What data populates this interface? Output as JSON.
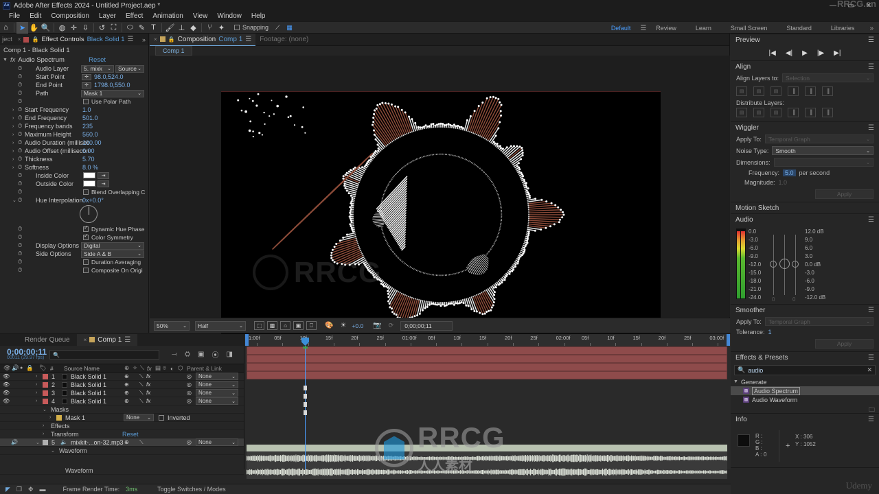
{
  "app": {
    "title": "Adobe After Effects 2024 - Untitled Project.aep *",
    "badge": "Ae",
    "window_buttons": [
      "—",
      "▭",
      "✕"
    ]
  },
  "menu": [
    "File",
    "Edit",
    "Composition",
    "Layer",
    "Effect",
    "Animation",
    "View",
    "Window",
    "Help"
  ],
  "toolbar": {
    "tools": [
      {
        "name": "home-icon",
        "glyph": "⌂"
      },
      {
        "name": "selection-tool-icon",
        "glyph": "➤"
      },
      {
        "name": "hand-tool-icon",
        "glyph": "✋"
      },
      {
        "name": "zoom-tool-icon",
        "glyph": "🔍"
      },
      {
        "name": "orbit-tool-icon",
        "glyph": "◍"
      },
      {
        "name": "pan-behind-tool-icon",
        "glyph": "✛"
      },
      {
        "name": "camera-tool-icon",
        "glyph": "⇩"
      },
      {
        "name": "rotation-tool-icon",
        "glyph": "↺"
      },
      {
        "name": "region-of-interest-icon",
        "glyph": "⛶"
      },
      {
        "name": "shape-tool-icon",
        "glyph": "⬭"
      },
      {
        "name": "pen-tool-icon",
        "glyph": "✎"
      },
      {
        "name": "type-tool-icon",
        "glyph": "T"
      },
      {
        "name": "brush-tool-icon",
        "glyph": "🖌"
      },
      {
        "name": "clone-stamp-tool-icon",
        "glyph": "⊥"
      },
      {
        "name": "eraser-tool-icon",
        "glyph": "◆"
      },
      {
        "name": "roto-brush-tool-icon",
        "glyph": "⑂"
      },
      {
        "name": "puppet-pin-tool-icon",
        "glyph": "✦"
      }
    ],
    "snapping_label": "Snapping",
    "snapping_checked": false
  },
  "workspaces": {
    "items": [
      "Default",
      "Review",
      "Learn",
      "Small Screen",
      "Standard",
      "Libraries"
    ],
    "active": "Default",
    "overflow": "»"
  },
  "effect_controls": {
    "tabs": [
      {
        "label": "ject",
        "active": false
      },
      {
        "label": "Effect Controls",
        "value": "Black Solid 1",
        "active": true
      }
    ],
    "subtitle": "Comp 1 - Black Solid 1",
    "effect_name": "Audio Spectrum",
    "reset_label": "Reset",
    "properties": [
      {
        "label": "Audio Layer",
        "indent": true,
        "type": "dual-dropdown",
        "value": "5. mixk",
        "value2": "Source"
      },
      {
        "label": "Start Point",
        "indent": true,
        "type": "point",
        "value": "98.0,524.0"
      },
      {
        "label": "End Point",
        "indent": true,
        "type": "point",
        "value": "1798.0,550.0"
      },
      {
        "label": "Path",
        "indent": true,
        "type": "dropdown",
        "value": "Mask 1"
      },
      {
        "label": "",
        "indent": true,
        "type": "checkbox",
        "value": "Use Polar Path",
        "checked": false
      },
      {
        "label": "Start Frequency",
        "indent": false,
        "type": "number",
        "value": "1.0"
      },
      {
        "label": "End Frequency",
        "indent": false,
        "type": "number",
        "value": "501.0"
      },
      {
        "label": "Frequency bands",
        "indent": false,
        "type": "number",
        "value": "235"
      },
      {
        "label": "Maximum Height",
        "indent": false,
        "type": "number",
        "value": "560.0"
      },
      {
        "label": "Audio Duration (millisec",
        "indent": false,
        "type": "number",
        "value": "100.00"
      },
      {
        "label": "Audio Offset (millisecon",
        "indent": false,
        "type": "number",
        "value": "0.00"
      },
      {
        "label": "Thickness",
        "indent": false,
        "type": "number",
        "value": "5.70"
      },
      {
        "label": "Softness",
        "indent": false,
        "type": "number",
        "value": "8.0 %"
      },
      {
        "label": "Inside Color",
        "indent": true,
        "type": "color",
        "value": "#ffffff"
      },
      {
        "label": "Outside Color",
        "indent": true,
        "type": "color",
        "value": "#ffffff"
      },
      {
        "label": "",
        "indent": true,
        "type": "checkbox",
        "value": "Blend Overlapping C",
        "checked": false
      },
      {
        "label": "Hue Interpolation",
        "indent": true,
        "type": "angle",
        "value": "0x+0.0°"
      },
      {
        "label": "",
        "indent": true,
        "type": "checkbox",
        "value": "Dynamic Hue Phase",
        "checked": true
      },
      {
        "label": "",
        "indent": true,
        "type": "checkbox",
        "value": "Color Symmetry",
        "checked": true
      },
      {
        "label": "Display Options",
        "indent": true,
        "type": "dropdown",
        "value": "Digital"
      },
      {
        "label": "Side Options",
        "indent": true,
        "type": "dropdown",
        "value": "Side A & B"
      },
      {
        "label": "",
        "indent": true,
        "type": "checkbox",
        "value": "Duration Averaging",
        "checked": false
      },
      {
        "label": "",
        "indent": true,
        "type": "checkbox",
        "value": "Composite On Origi",
        "checked": false
      }
    ]
  },
  "composition": {
    "tab_label": "Composition",
    "tab_value": "Comp 1",
    "footage_label": "Footage: (none)",
    "view_tab": "Comp 1",
    "viewer_bar": {
      "zoom": "50%",
      "resolution": "Half",
      "exposure": "+0.0",
      "timecode": "0;00;00;11",
      "icons": [
        "region-of-interest-icon",
        "transparency-grid-icon",
        "mask-view-icon",
        "title-safe-icon",
        "snapshot-view-icon",
        "channel-icon",
        "exposure-icon",
        "camera-icon",
        "reset-exposure-icon"
      ]
    }
  },
  "preview": {
    "title": "Preview",
    "buttons": [
      "first-frame",
      "prev-frame",
      "play",
      "next-frame",
      "last-frame"
    ],
    "glyphs": [
      "|◀",
      "◀|",
      "▶",
      "|▶",
      "▶|"
    ]
  },
  "align": {
    "title": "Align",
    "align_label": "Align Layers to:",
    "align_value": "Selection",
    "distribute_label": "Distribute Layers:"
  },
  "wiggler": {
    "title": "Wiggler",
    "apply_to_label": "Apply To:",
    "apply_to_value": "Temporal Graph",
    "noise_type_label": "Noise Type:",
    "noise_type_value": "Smooth",
    "dimensions_label": "Dimensions:",
    "dimensions_value": "",
    "frequency_label": "Frequency:",
    "frequency_value": "5.0",
    "frequency_unit": "per second",
    "magnitude_label": "Magnitude:",
    "magnitude_value": "1.0",
    "apply_label": "Apply"
  },
  "motion_sketch": {
    "title": "Motion Sketch"
  },
  "audio_panel": {
    "title": "Audio",
    "left_scale": [
      "0.0",
      "-3.0",
      "-6.0",
      "-9.0",
      "-12.0",
      "-15.0",
      "-18.0",
      "-21.0",
      "-24.0"
    ],
    "right_scale": [
      "12.0 dB",
      "9.0",
      "6.0",
      "3.0",
      "0.0 dB",
      "-3.0",
      "-6.0",
      "-9.0",
      "-12.0 dB"
    ],
    "bottom_values": [
      "0",
      "0"
    ]
  },
  "smoother": {
    "title": "Smoother",
    "apply_to_label": "Apply To:",
    "apply_to_value": "Temporal Graph",
    "tolerance_label": "Tolerance:",
    "tolerance_value": "1",
    "apply_label": "Apply"
  },
  "effects_presets": {
    "title": "Effects & Presets",
    "search_value": "audio",
    "group": "Generate",
    "items": [
      {
        "label": "Audio Spectrum",
        "selected": true
      },
      {
        "label": "Audio Waveform",
        "selected": false
      }
    ]
  },
  "info": {
    "title": "Info",
    "r_label": "R :",
    "g_label": "G :",
    "b_label": "B :",
    "a_label": "A :",
    "r_value": "",
    "g_value": "",
    "b_value": "",
    "a_value": "0",
    "x_label": "X :",
    "x_value": "306",
    "y_label": "Y :",
    "y_value": "1052"
  },
  "timeline": {
    "tabs": [
      {
        "label": "Render Queue",
        "active": false
      },
      {
        "label": "Comp 1",
        "active": true
      }
    ],
    "current_time": "0;00;00;11",
    "fps_note": "00011 (29.97 fps)",
    "search_placeholder": "",
    "columns": [
      "#",
      "Source Name",
      "Parent & Link"
    ],
    "layers": [
      {
        "index": "1",
        "name": "Black Solid 1",
        "parent": "None",
        "color": "#c85a5a",
        "type": "solid"
      },
      {
        "index": "2",
        "name": "Black Solid 1",
        "parent": "None",
        "color": "#c85a5a",
        "type": "solid"
      },
      {
        "index": "3",
        "name": "Black Solid 1",
        "parent": "None",
        "color": "#c85a5a",
        "type": "solid"
      },
      {
        "index": "4",
        "name": "Black Solid 1",
        "parent": "None",
        "color": "#c85a5a",
        "type": "solid"
      }
    ],
    "sublayers": [
      {
        "label": "Masks",
        "depth": 1
      },
      {
        "label": "Mask 1",
        "depth": 2,
        "mode": "None",
        "inverted": "Inverted"
      },
      {
        "label": "Effects",
        "depth": 1
      },
      {
        "label": "Transform",
        "depth": 1,
        "reset": "Reset"
      }
    ],
    "audio_layer": {
      "index": "5",
      "name": "mixkit-...on-32.mp3",
      "parent": "None"
    },
    "waveform_label": "Waveform",
    "waveform_label2": "Waveform",
    "ruler_ticks": [
      "1:00f",
      "05f",
      "10f",
      "15f",
      "20f",
      "25f",
      "01:00f",
      "05f",
      "10f",
      "15f",
      "20f",
      "25f",
      "02:00f",
      "05f",
      "10f",
      "15f",
      "20f",
      "25f",
      "03:00f"
    ],
    "frame_render_label": "Frame Render Time:",
    "frame_render_value": "3ms",
    "toggle_label": "Toggle Switches / Modes"
  },
  "watermarks": {
    "brand": "RRCG",
    "brand_sub": "人人素材",
    "corner": "RRCG.cn",
    "udemy": "Udemy"
  },
  "colors": {
    "accent_blue": "#4a9eff",
    "layer_red": "#8e4b4b",
    "audio_green": "#b8c2b0",
    "panel_bg": "#262626",
    "dark_bg": "#1c1c1c"
  }
}
